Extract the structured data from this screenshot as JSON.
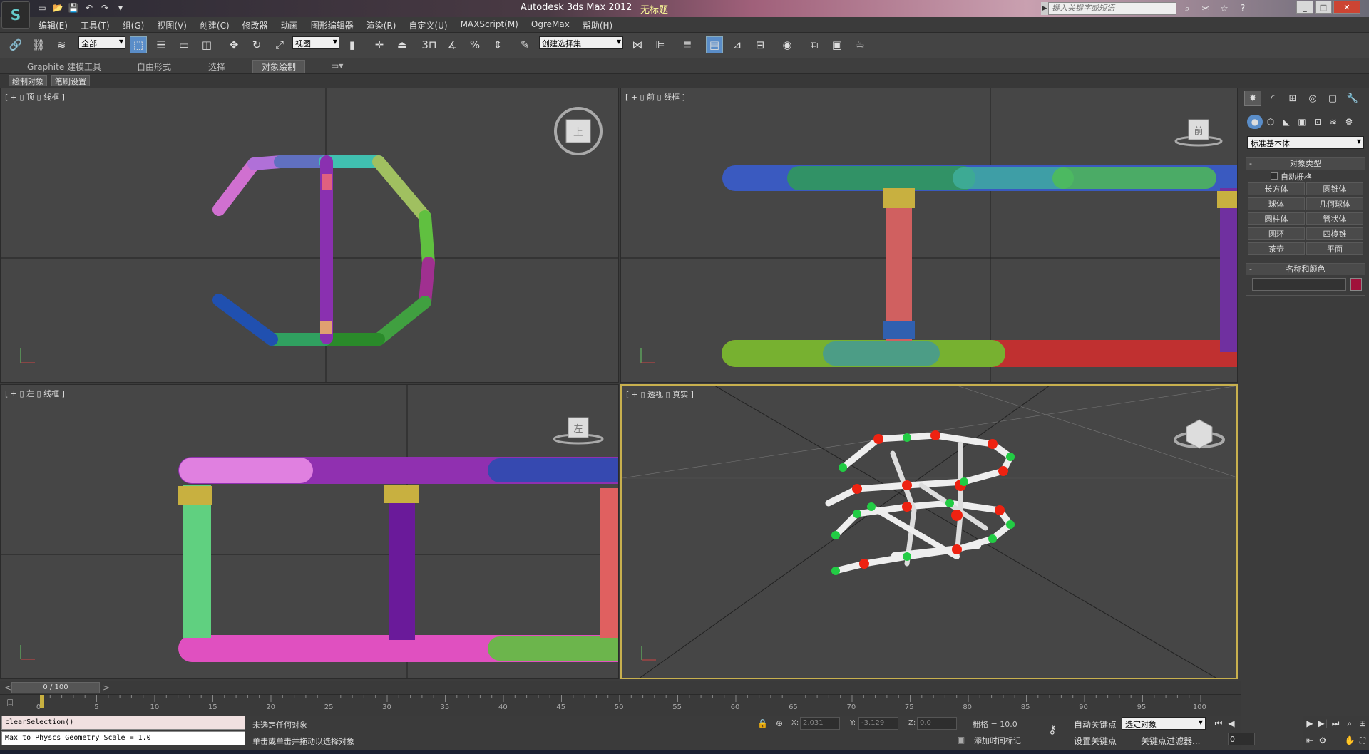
{
  "app": {
    "title": "Autodesk 3ds Max  2012",
    "document": "无标题",
    "logo": "S"
  },
  "quick_access": [
    {
      "icon": "new-file-icon",
      "glyph": "▭"
    },
    {
      "icon": "open-file-icon",
      "glyph": "📂"
    },
    {
      "icon": "save-icon",
      "glyph": "💾"
    },
    {
      "icon": "undo-icon",
      "glyph": "↶"
    },
    {
      "icon": "redo-icon",
      "glyph": "↷"
    },
    {
      "icon": "customize-icon",
      "glyph": "▾"
    }
  ],
  "search": {
    "placeholder": "键入关键字或短语"
  },
  "info_center": [
    {
      "icon": "binoculars-icon",
      "glyph": "⌕"
    },
    {
      "icon": "tools-icon",
      "glyph": "✂"
    },
    {
      "icon": "star-icon",
      "glyph": "☆"
    },
    {
      "icon": "help-icon",
      "glyph": "?"
    }
  ],
  "window_controls": {
    "min": "_",
    "max": "□",
    "close": "✕"
  },
  "menus": [
    "编辑(E)",
    "工具(T)",
    "组(G)",
    "视图(V)",
    "创建(C)",
    "修改器",
    "动画",
    "图形编辑器",
    "渲染(R)",
    "自定义(U)",
    "MAXScript(M)",
    "OgreMax",
    "帮助(H)"
  ],
  "toolbar": {
    "selection_filter": "全部",
    "ref_coord": "视图",
    "named_selection": "创建选择集",
    "snap_label": "3"
  },
  "ribbon": {
    "tabs": [
      "Graphite 建模工具",
      "自由形式",
      "选择",
      "对象绘制"
    ],
    "active": "对象绘制",
    "sub_buttons": [
      "绘制对象",
      "笔刷设置"
    ]
  },
  "viewports": {
    "top": {
      "label": "[ + ▯ 顶 ▯ 线框 ]",
      "cube": "上"
    },
    "front": {
      "label": "[ + ▯ 前 ▯ 线框 ]",
      "cube": "前"
    },
    "left": {
      "label": "[ + ▯ 左 ▯ 线框 ]",
      "cube": "左"
    },
    "persp": {
      "label": "[ + ▯ 透视 ▯ 真实 ]"
    }
  },
  "command_panel": {
    "dropdown": "标准基本体",
    "rollout_object_type": "对象类型",
    "autogrid": "自动栅格",
    "objects": [
      "长方体",
      "圆锥体",
      "球体",
      "几何球体",
      "圆柱体",
      "管状体",
      "圆环",
      "四棱锥",
      "茶壶",
      "平面"
    ],
    "rollout_name_color": "名称和颜色"
  },
  "time_slider": {
    "label": "0 / 100",
    "prev": "<",
    "next": ">"
  },
  "ruler_ticks": [
    "0",
    "5",
    "10",
    "15",
    "20",
    "25",
    "30",
    "35",
    "40",
    "45",
    "50",
    "55",
    "60",
    "65",
    "70",
    "75",
    "80",
    "85",
    "90",
    "95",
    "100"
  ],
  "status": {
    "maxscript_1": "clearSelection()",
    "maxscript_2": "Max to Physcs Geometry Scale = 1.0",
    "selection": "未选定任何对象",
    "prompt": "单击或单击并拖动以选择对象",
    "x_label": "X:",
    "x_value": "2.031",
    "y_label": "Y:",
    "y_value": "-3.129",
    "z_label": "Z:",
    "z_value": "0.0",
    "grid": "栅格 = 10.0",
    "auto_key": "自动关键点",
    "set_key": "设置关键点",
    "key_mode": "选定对象",
    "key_filter": "关键点过滤器...",
    "add_time_tag": "添加时间标记",
    "frame": "0"
  }
}
